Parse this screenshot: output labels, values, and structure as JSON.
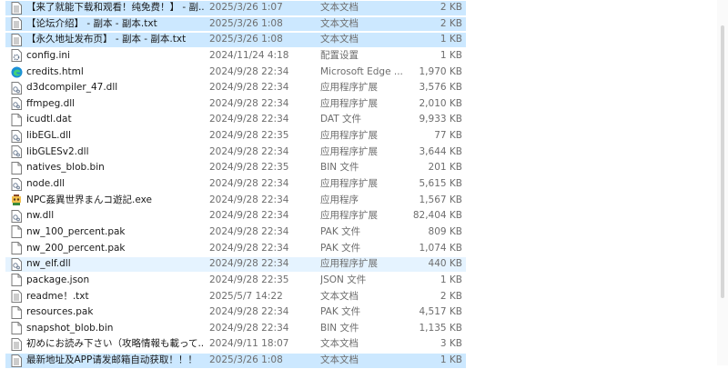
{
  "files": [
    {
      "name": "【来了就能下载和观看！纯免费！】 - 副...",
      "date": "2025/3/26 1:07",
      "type": "文本文档",
      "size": "2 KB",
      "icon": "text-file-icon",
      "state": "sel"
    },
    {
      "name": "【论坛介绍】 - 副本 - 副本.txt",
      "date": "2025/3/26 1:08",
      "type": "文本文档",
      "size": "2 KB",
      "icon": "text-file-icon",
      "state": "sel"
    },
    {
      "name": "【永久地址发布页】 - 副本 - 副本.txt",
      "date": "2025/3/26 1:08",
      "type": "文本文档",
      "size": "1 KB",
      "icon": "text-file-icon",
      "state": "sel"
    },
    {
      "name": "config.ini",
      "date": "2024/11/24 4:18",
      "type": "配置设置",
      "size": "1 KB",
      "icon": "settings-file-icon",
      "state": ""
    },
    {
      "name": "credits.html",
      "date": "2024/9/28 22:34",
      "type": "Microsoft Edge ...",
      "size": "1,970 KB",
      "icon": "edge-icon",
      "state": ""
    },
    {
      "name": "d3dcompiler_47.dll",
      "date": "2024/9/28 22:34",
      "type": "应用程序扩展",
      "size": "3,576 KB",
      "icon": "dll-file-icon",
      "state": ""
    },
    {
      "name": "ffmpeg.dll",
      "date": "2024/9/28 22:34",
      "type": "应用程序扩展",
      "size": "2,010 KB",
      "icon": "dll-file-icon",
      "state": ""
    },
    {
      "name": "icudtl.dat",
      "date": "2024/9/28 22:34",
      "type": "DAT 文件",
      "size": "9,933 KB",
      "icon": "blank-file-icon",
      "state": ""
    },
    {
      "name": "libEGL.dll",
      "date": "2024/9/28 22:35",
      "type": "应用程序扩展",
      "size": "77 KB",
      "icon": "dll-file-icon",
      "state": ""
    },
    {
      "name": "libGLESv2.dll",
      "date": "2024/9/28 22:34",
      "type": "应用程序扩展",
      "size": "3,644 KB",
      "icon": "dll-file-icon",
      "state": ""
    },
    {
      "name": "natives_blob.bin",
      "date": "2024/9/28 22:35",
      "type": "BIN 文件",
      "size": "201 KB",
      "icon": "blank-file-icon",
      "state": ""
    },
    {
      "name": "node.dll",
      "date": "2024/9/28 22:34",
      "type": "应用程序扩展",
      "size": "5,615 KB",
      "icon": "dll-file-icon",
      "state": ""
    },
    {
      "name": "NPC姦異世界まんコ遊記.exe",
      "date": "2024/9/28 22:34",
      "type": "应用程序",
      "size": "1,567 KB",
      "icon": "app-exe-icon",
      "state": ""
    },
    {
      "name": "nw.dll",
      "date": "2024/9/28 22:34",
      "type": "应用程序扩展",
      "size": "82,404 KB",
      "icon": "dll-file-icon",
      "state": ""
    },
    {
      "name": "nw_100_percent.pak",
      "date": "2024/9/28 22:34",
      "type": "PAK 文件",
      "size": "809 KB",
      "icon": "blank-file-icon",
      "state": ""
    },
    {
      "name": "nw_200_percent.pak",
      "date": "2024/9/28 22:34",
      "type": "PAK 文件",
      "size": "1,074 KB",
      "icon": "blank-file-icon",
      "state": ""
    },
    {
      "name": "nw_elf.dll",
      "date": "2024/9/28 22:34",
      "type": "应用程序扩展",
      "size": "440 KB",
      "icon": "dll-file-icon",
      "state": "hov"
    },
    {
      "name": "package.json",
      "date": "2024/9/28 22:35",
      "type": "JSON 文件",
      "size": "1 KB",
      "icon": "blank-file-icon",
      "state": ""
    },
    {
      "name": "readme！.txt",
      "date": "2025/5/7 14:22",
      "type": "文本文档",
      "size": "2 KB",
      "icon": "text-file-icon",
      "state": ""
    },
    {
      "name": "resources.pak",
      "date": "2024/9/28 22:34",
      "type": "PAK 文件",
      "size": "4,517 KB",
      "icon": "blank-file-icon",
      "state": ""
    },
    {
      "name": "snapshot_blob.bin",
      "date": "2024/9/28 22:34",
      "type": "BIN 文件",
      "size": "1,135 KB",
      "icon": "blank-file-icon",
      "state": ""
    },
    {
      "name": "初めにお読み下さい（攻略情報も載って...",
      "date": "2024/9/11 18:07",
      "type": "文本文档",
      "size": "3 KB",
      "icon": "text-file-icon",
      "state": ""
    },
    {
      "name": "最新地址及APP请发邮箱自动获取！！！",
      "date": "2025/3/26 1:08",
      "type": "文本文档",
      "size": "1 KB",
      "icon": "text-file-icon",
      "state": "sel"
    }
  ]
}
